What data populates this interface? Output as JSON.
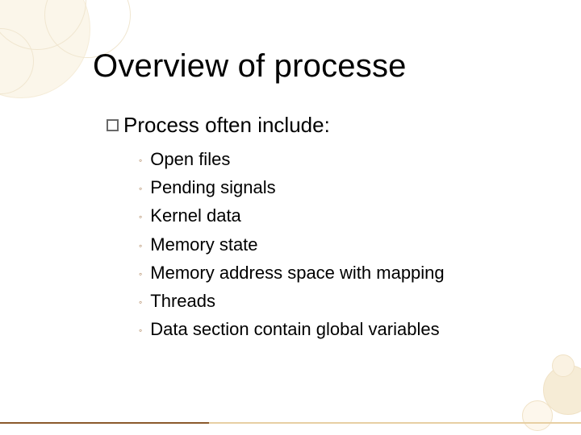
{
  "title": "Overview of processe",
  "lead": "Process often include:",
  "items": [
    "Open files",
    "Pending signals",
    "Kernel data",
    "Memory state",
    "Memory address space with mapping",
    "Threads",
    "Data section contain global variables"
  ],
  "theme": {
    "accent_brown": "#8b5a2b",
    "accent_tan": "#e7cfa3",
    "bullet_color": "#9c6a3a"
  }
}
